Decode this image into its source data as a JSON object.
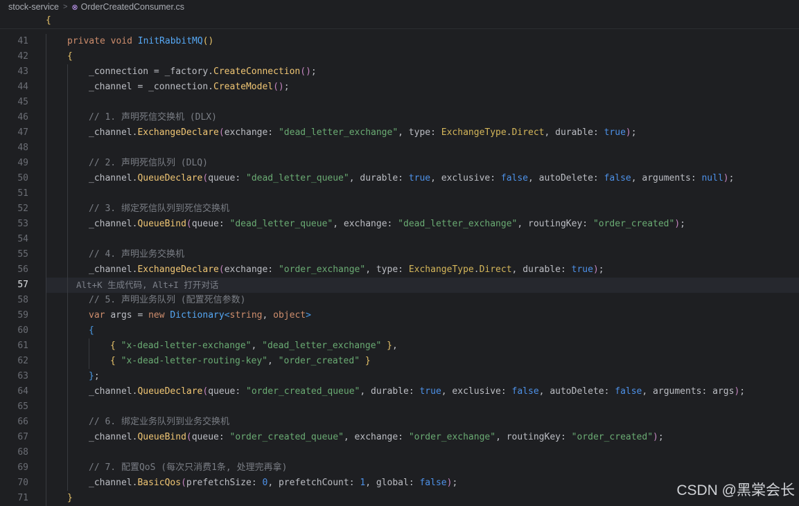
{
  "breadcrumb": {
    "project": "stock-service",
    "file": "OrderCreatedConsumer.cs",
    "separator": ">",
    "file_icon": "class-icon"
  },
  "sticky_header": {
    "brace": "{"
  },
  "current_line": 57,
  "inline_hint": "Alt+K 生成代码, Alt+I 打开对话",
  "watermark": "CSDN @黑棠会长",
  "lines": [
    {
      "n": 41,
      "indent": 1,
      "tokens": [
        [
          "kw",
          "private void "
        ],
        [
          "fn",
          "InitRabbitMQ"
        ],
        [
          "p1",
          "()"
        ]
      ]
    },
    {
      "n": 42,
      "indent": 1,
      "tokens": [
        [
          "p1",
          "{"
        ]
      ]
    },
    {
      "n": 43,
      "indent": 2,
      "tokens": [
        [
          "pl",
          "_connection = _factory."
        ],
        [
          "mc",
          "CreateConnection"
        ],
        [
          "p2",
          "()"
        ],
        [
          "pl",
          ";"
        ]
      ]
    },
    {
      "n": 44,
      "indent": 2,
      "tokens": [
        [
          "pl",
          "_channel = _connection."
        ],
        [
          "mc",
          "CreateModel"
        ],
        [
          "p2",
          "()"
        ],
        [
          "pl",
          ";"
        ]
      ]
    },
    {
      "n": 45,
      "indent": 2,
      "tokens": []
    },
    {
      "n": 46,
      "indent": 2,
      "tokens": [
        [
          "cm",
          "// 1. 声明死信交换机 (DLX)"
        ]
      ]
    },
    {
      "n": 47,
      "indent": 2,
      "tokens": [
        [
          "pl",
          "_channel."
        ],
        [
          "mc",
          "ExchangeDeclare"
        ],
        [
          "p2",
          "("
        ],
        [
          "pl",
          "exchange: "
        ],
        [
          "str",
          "\"dead_letter_exchange\""
        ],
        [
          "pl",
          ", type: "
        ],
        [
          "ty",
          "ExchangeType"
        ],
        [
          "pl",
          "."
        ],
        [
          "ty",
          "Direct"
        ],
        [
          "pl",
          ", durable: "
        ],
        [
          "lit",
          "true"
        ],
        [
          "p2",
          ")"
        ],
        [
          "pl",
          ";"
        ]
      ]
    },
    {
      "n": 48,
      "indent": 2,
      "tokens": []
    },
    {
      "n": 49,
      "indent": 2,
      "tokens": [
        [
          "cm",
          "// 2. 声明死信队列 (DLQ)"
        ]
      ]
    },
    {
      "n": 50,
      "indent": 2,
      "tokens": [
        [
          "pl",
          "_channel."
        ],
        [
          "mc",
          "QueueDeclare"
        ],
        [
          "p2",
          "("
        ],
        [
          "pl",
          "queue: "
        ],
        [
          "str",
          "\"dead_letter_queue\""
        ],
        [
          "pl",
          ", durable: "
        ],
        [
          "lit",
          "true"
        ],
        [
          "pl",
          ", exclusive: "
        ],
        [
          "lit",
          "false"
        ],
        [
          "pl",
          ", autoDelete: "
        ],
        [
          "lit",
          "false"
        ],
        [
          "pl",
          ", arguments: "
        ],
        [
          "lit",
          "null"
        ],
        [
          "p2",
          ")"
        ],
        [
          "pl",
          ";"
        ]
      ]
    },
    {
      "n": 51,
      "indent": 2,
      "tokens": []
    },
    {
      "n": 52,
      "indent": 2,
      "tokens": [
        [
          "cm",
          "// 3. 绑定死信队列到死信交换机"
        ]
      ]
    },
    {
      "n": 53,
      "indent": 2,
      "tokens": [
        [
          "pl",
          "_channel."
        ],
        [
          "mc",
          "QueueBind"
        ],
        [
          "p2",
          "("
        ],
        [
          "pl",
          "queue: "
        ],
        [
          "str",
          "\"dead_letter_queue\""
        ],
        [
          "pl",
          ", exchange: "
        ],
        [
          "str",
          "\"dead_letter_exchange\""
        ],
        [
          "pl",
          ", routingKey: "
        ],
        [
          "str",
          "\"order_created\""
        ],
        [
          "p2",
          ")"
        ],
        [
          "pl",
          ";"
        ]
      ]
    },
    {
      "n": 54,
      "indent": 2,
      "tokens": []
    },
    {
      "n": 55,
      "indent": 2,
      "tokens": [
        [
          "cm",
          "// 4. 声明业务交换机"
        ]
      ]
    },
    {
      "n": 56,
      "indent": 2,
      "tokens": [
        [
          "pl",
          "_channel."
        ],
        [
          "mc",
          "ExchangeDeclare"
        ],
        [
          "p2",
          "("
        ],
        [
          "pl",
          "exchange: "
        ],
        [
          "str",
          "\"order_exchange\""
        ],
        [
          "pl",
          ", type: "
        ],
        [
          "ty",
          "ExchangeType"
        ],
        [
          "pl",
          "."
        ],
        [
          "ty",
          "Direct"
        ],
        [
          "pl",
          ", durable: "
        ],
        [
          "lit",
          "true"
        ],
        [
          "p2",
          ")"
        ],
        [
          "pl",
          ";"
        ]
      ]
    },
    {
      "n": 57,
      "indent": 2,
      "tokens": [],
      "hint": true
    },
    {
      "n": 58,
      "indent": 2,
      "tokens": [
        [
          "cm",
          "// 5. 声明业务队列 (配置死信参数)"
        ]
      ]
    },
    {
      "n": 59,
      "indent": 2,
      "tokens": [
        [
          "kw",
          "var "
        ],
        [
          "pl",
          "args = "
        ],
        [
          "kw",
          "new "
        ],
        [
          "fn",
          "Dictionary"
        ],
        [
          "p3",
          "<"
        ],
        [
          "kw",
          "string"
        ],
        [
          "pl",
          ", "
        ],
        [
          "kw",
          "object"
        ],
        [
          "p3",
          ">"
        ]
      ]
    },
    {
      "n": 60,
      "indent": 2,
      "tokens": [
        [
          "p3",
          "{"
        ]
      ]
    },
    {
      "n": 61,
      "indent": 3,
      "tokens": [
        [
          "p1",
          "{ "
        ],
        [
          "str",
          "\"x-dead-letter-exchange\""
        ],
        [
          "pl",
          ", "
        ],
        [
          "str",
          "\"dead_letter_exchange\""
        ],
        [
          "p1",
          " }"
        ],
        [
          "pl",
          ","
        ]
      ]
    },
    {
      "n": 62,
      "indent": 3,
      "tokens": [
        [
          "p1",
          "{ "
        ],
        [
          "str",
          "\"x-dead-letter-routing-key\""
        ],
        [
          "pl",
          ", "
        ],
        [
          "str",
          "\"order_created\""
        ],
        [
          "p1",
          " }"
        ]
      ]
    },
    {
      "n": 63,
      "indent": 2,
      "tokens": [
        [
          "p3",
          "}"
        ],
        [
          "pl",
          ";"
        ]
      ]
    },
    {
      "n": 64,
      "indent": 2,
      "tokens": [
        [
          "pl",
          "_channel."
        ],
        [
          "mc",
          "QueueDeclare"
        ],
        [
          "p2",
          "("
        ],
        [
          "pl",
          "queue: "
        ],
        [
          "str",
          "\"order_created_queue\""
        ],
        [
          "pl",
          ", durable: "
        ],
        [
          "lit",
          "true"
        ],
        [
          "pl",
          ", exclusive: "
        ],
        [
          "lit",
          "false"
        ],
        [
          "pl",
          ", autoDelete: "
        ],
        [
          "lit",
          "false"
        ],
        [
          "pl",
          ", arguments: args"
        ],
        [
          "p2",
          ")"
        ],
        [
          "pl",
          ";"
        ]
      ]
    },
    {
      "n": 65,
      "indent": 2,
      "tokens": []
    },
    {
      "n": 66,
      "indent": 2,
      "tokens": [
        [
          "cm",
          "// 6. 绑定业务队列到业务交换机"
        ]
      ]
    },
    {
      "n": 67,
      "indent": 2,
      "tokens": [
        [
          "pl",
          "_channel."
        ],
        [
          "mc",
          "QueueBind"
        ],
        [
          "p2",
          "("
        ],
        [
          "pl",
          "queue: "
        ],
        [
          "str",
          "\"order_created_queue\""
        ],
        [
          "pl",
          ", exchange: "
        ],
        [
          "str",
          "\"order_exchange\""
        ],
        [
          "pl",
          ", routingKey: "
        ],
        [
          "str",
          "\"order_created\""
        ],
        [
          "p2",
          ")"
        ],
        [
          "pl",
          ";"
        ]
      ]
    },
    {
      "n": 68,
      "indent": 2,
      "tokens": []
    },
    {
      "n": 69,
      "indent": 2,
      "tokens": [
        [
          "cm",
          "// 7. 配置QoS (每次只消费1条, 处理完再拿)"
        ]
      ]
    },
    {
      "n": 70,
      "indent": 2,
      "tokens": [
        [
          "pl",
          "_channel."
        ],
        [
          "mc",
          "BasicQos"
        ],
        [
          "p2",
          "("
        ],
        [
          "pl",
          "prefetchSize: "
        ],
        [
          "lit",
          "0"
        ],
        [
          "pl",
          ", prefetchCount: "
        ],
        [
          "lit",
          "1"
        ],
        [
          "pl",
          ", global: "
        ],
        [
          "lit",
          "false"
        ],
        [
          "p2",
          ")"
        ],
        [
          "pl",
          ";"
        ]
      ]
    },
    {
      "n": 71,
      "indent": 1,
      "tokens": [
        [
          "p1",
          "}"
        ]
      ]
    }
  ]
}
